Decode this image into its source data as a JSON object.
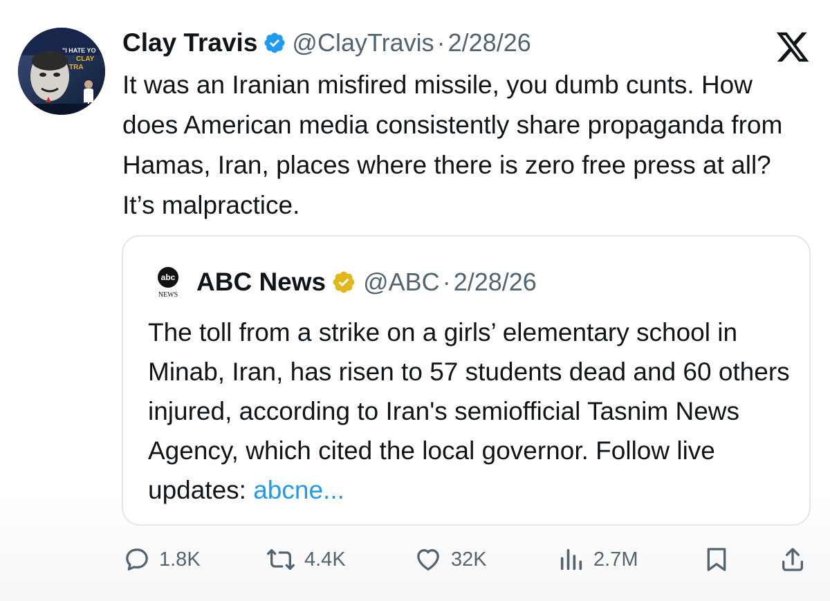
{
  "tweet": {
    "author_name": "Clay Travis",
    "handle": "@ClayTravis",
    "separator": "·",
    "date": "2/28/26",
    "text": "It was an Iranian misfired missile, you dumb cunts. How does American media consistently share propaganda from Hamas, Iran, places where there is zero free press at all? It’s malpractice.",
    "avatar_caption": "\"I HATE YOU CLAY TRAVIS\""
  },
  "quote": {
    "author_name": "ABC News",
    "handle": "@ABC",
    "separator": "·",
    "date": "2/28/26",
    "logo_text": "abc",
    "logo_subtext": "NEWS",
    "text": "The toll from a strike on a girls’ elementary school in Minab, Iran, has risen to 57 students dead and 60 others injured, according to Iran's semiofficial Tasnim News Agency, which cited the local governor. Follow live updates: ",
    "link_text": "abcne..."
  },
  "actions": {
    "replies": "1.8K",
    "reposts": "4.4K",
    "likes": "32K",
    "views": "2.7M"
  },
  "icons": {
    "platform": "x-logo-icon",
    "verified_user": "verified-badge-blue-icon",
    "verified_org": "verified-badge-gold-icon",
    "reply": "reply-icon",
    "repost": "repost-icon",
    "like": "heart-icon",
    "views": "views-icon",
    "bookmark": "bookmark-icon",
    "share": "share-icon"
  },
  "colors": {
    "text": "#0f1419",
    "secondary": "#536471",
    "link": "#1d9bf0",
    "verified_blue": "#1d9bf0",
    "verified_gold": "#e2b719",
    "border": "#e1e6ea"
  }
}
